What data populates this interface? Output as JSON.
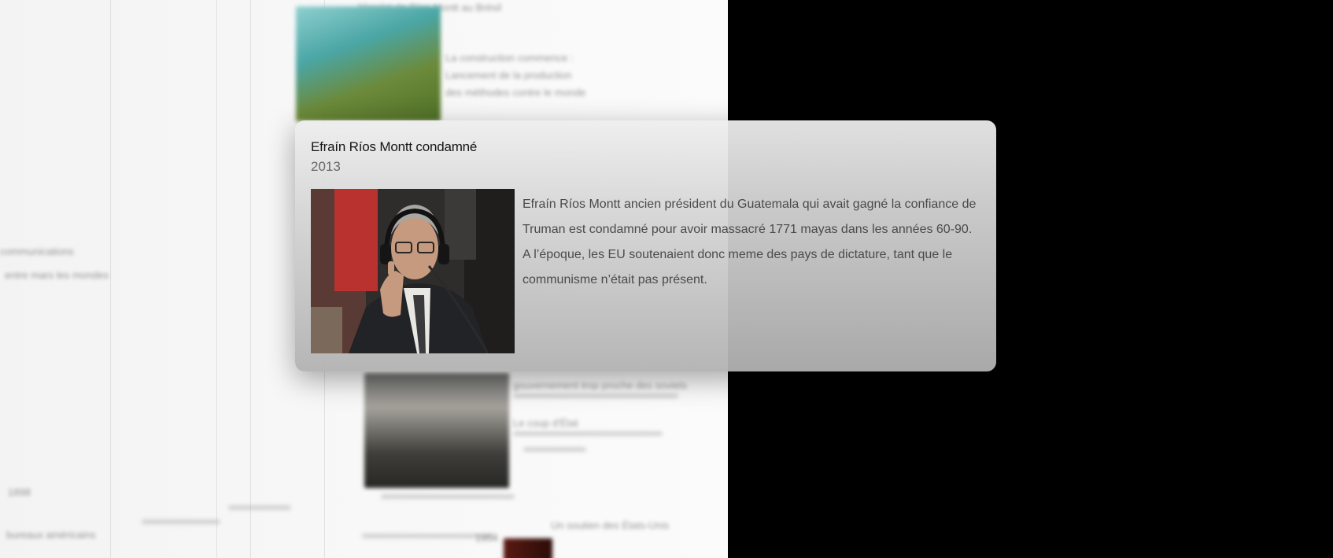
{
  "background_content": {
    "top_fragment": "Mandat de Ríos Montt au Brésil",
    "middle_fragment_1": "La construction commence :",
    "middle_fragment_2": "Lancement de la production",
    "middle_fragment_3": "des méthodes contre le monde",
    "left_fragment_1": "communications",
    "left_fragment_2": "entre mars les mondes",
    "left_fragment_3": "1898",
    "left_fragment_4": "bureaux américains",
    "lower_fragment_1": "gouvernement trop proche des soviets",
    "lower_fragment_2": "Le coup d'État",
    "lower_fragment_3": "1954",
    "lower_fragment_4": "Un soutien des États-Unis"
  },
  "event": {
    "title": "Efraín Ríos Montt condamné",
    "year": "2013",
    "image_alt": "Efraín Ríos Montt au tribunal",
    "description": "Efraín Ríos Montt ancien président du Guatemala qui avait gagné la confiance de Truman est condamné pour avoir massacré 1771 mayas dans les années 60-90. A l’époque, les EU soutenaient donc meme des pays de dictature, tant que le communisme n’était pas présent."
  },
  "colors": {
    "outside": "#000000",
    "page": "#f6f6f6",
    "card_top": "#eeeeee",
    "card_bottom": "#b2b2b2",
    "title_text": "#151515",
    "body_text": "#4a4a4a"
  }
}
